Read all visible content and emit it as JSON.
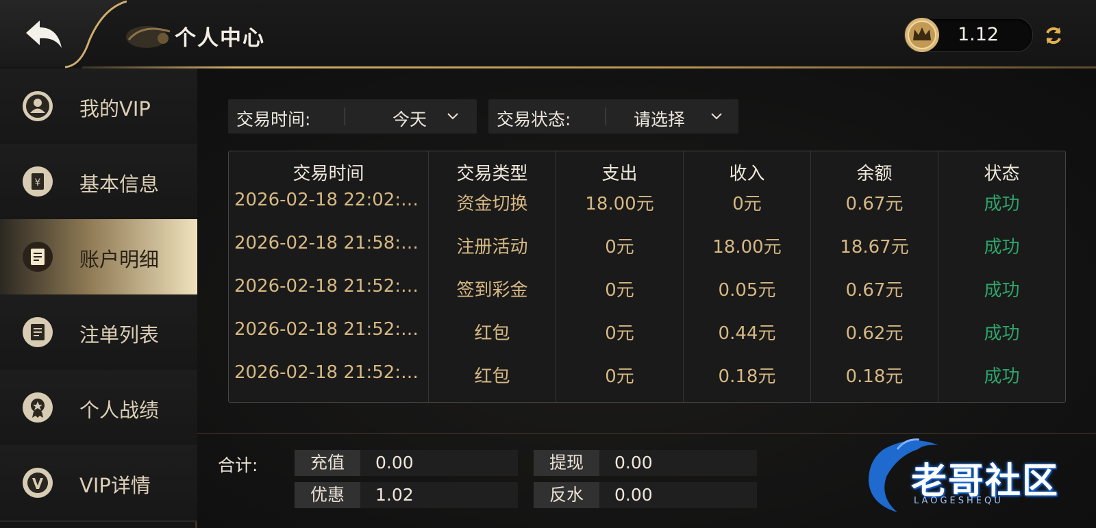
{
  "header": {
    "title": "个人中心",
    "balance": "1.12",
    "icons": {
      "back": "back-arrow-icon",
      "coin": "crown-coin-icon",
      "refresh": "refresh-icon"
    }
  },
  "sidebar": {
    "items": [
      {
        "label": "我的VIP",
        "icon": "user-icon",
        "active": false
      },
      {
        "label": "基本信息",
        "icon": "yuan-icon",
        "active": false
      },
      {
        "label": "账户明细",
        "icon": "checklist-icon",
        "active": true
      },
      {
        "label": "注单列表",
        "icon": "checklist-icon",
        "active": false
      },
      {
        "label": "个人战绩",
        "icon": "medal-icon",
        "active": false
      },
      {
        "label": "VIP详情",
        "icon": "vip-badge-icon",
        "active": false
      }
    ]
  },
  "filters": {
    "time_label": "交易时间:",
    "time_value": "今天",
    "status_label": "交易状态:",
    "status_value": "请选择"
  },
  "table": {
    "headers": [
      "交易时间",
      "交易类型",
      "支出",
      "收入",
      "余额",
      "状态"
    ],
    "rows": [
      [
        "2026-02-18 22:02:…",
        "资金切换",
        "18.00元",
        "0元",
        "0.67元",
        "成功"
      ],
      [
        "2026-02-18 21:58:…",
        "注册活动",
        "0元",
        "18.00元",
        "18.67元",
        "成功"
      ],
      [
        "2026-02-18 21:52:…",
        "签到彩金",
        "0元",
        "0.05元",
        "0.67元",
        "成功"
      ],
      [
        "2026-02-18 21:52:…",
        "红包",
        "0元",
        "0.44元",
        "0.62元",
        "成功"
      ],
      [
        "2026-02-18 21:52:…",
        "红包",
        "0元",
        "0.18元",
        "0.18元",
        "成功"
      ]
    ]
  },
  "summary": {
    "label": "合计:",
    "items": [
      {
        "key": "充值",
        "value": "0.00"
      },
      {
        "key": "提现",
        "value": "0.00"
      },
      {
        "key": "优惠",
        "value": "1.02"
      },
      {
        "key": "反水",
        "value": "0.00"
      }
    ]
  },
  "watermark": {
    "text": "老哥社区",
    "sub": "LAOGESHEQU"
  },
  "colors": {
    "gold": "#d6b883",
    "success": "#2ea56a",
    "accent": "#cfae6c"
  }
}
